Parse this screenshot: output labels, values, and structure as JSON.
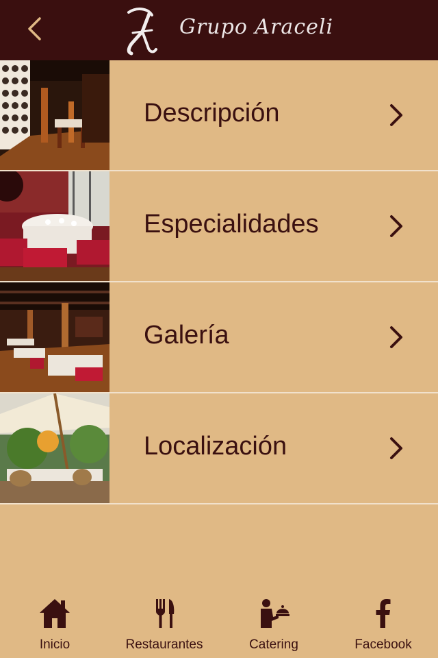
{
  "header": {
    "logo_text": "Grupo Araceli",
    "accent": "#3a0f0f"
  },
  "menu": {
    "items": [
      {
        "label": "Descripción",
        "icon": "chevron-right-icon"
      },
      {
        "label": "Especialidades",
        "icon": "chevron-right-icon"
      },
      {
        "label": "Galería",
        "icon": "chevron-right-icon"
      },
      {
        "label": "Localización",
        "icon": "chevron-right-icon"
      }
    ]
  },
  "tabbar": {
    "items": [
      {
        "label": "Inicio",
        "icon": "home-icon"
      },
      {
        "label": "Restaurantes",
        "icon": "fork-knife-icon"
      },
      {
        "label": "Catering",
        "icon": "waiter-cloche-icon"
      },
      {
        "label": "Facebook",
        "icon": "facebook-icon"
      }
    ]
  },
  "colors": {
    "background": "#e0b985",
    "text": "#3a1010",
    "divider": "#f1e1cc"
  }
}
